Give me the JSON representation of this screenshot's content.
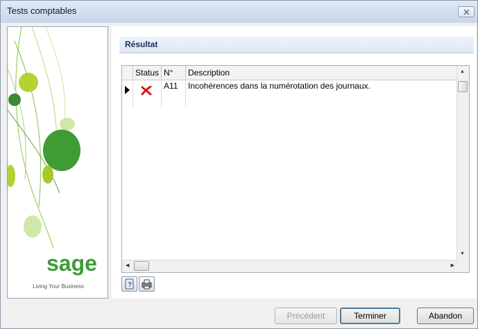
{
  "window": {
    "title": "Tests comptables"
  },
  "brand": {
    "logo_text": "sage",
    "tagline": "Living Your Business",
    "logo_color": "#3f9c35"
  },
  "result": {
    "section_title": "Résultat",
    "columns": [
      "Status",
      "N°",
      "Description"
    ],
    "rows": [
      {
        "status_icon": "error-x-icon",
        "number": "A11",
        "description": "Incohérences dans la numérotation des journaux."
      }
    ]
  },
  "buttons": {
    "previous": "Précédent",
    "finish": "Terminer",
    "abort": "Abandon"
  },
  "colors": {
    "error_red": "#d41a1a",
    "section_title": "#1a2c5a"
  }
}
